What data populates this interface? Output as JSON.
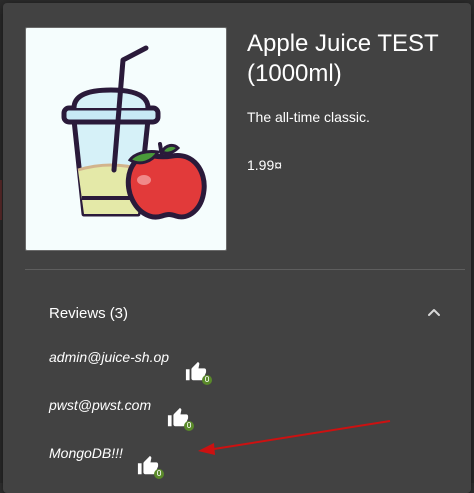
{
  "product": {
    "title": "Apple Juice TEST (1000ml)",
    "description": "The all-time classic.",
    "price": "1.99¤",
    "image_icon": "apple-juice-cup-illustration"
  },
  "reviews": {
    "label": "Reviews",
    "count": "(3)",
    "expanded": true,
    "items": [
      {
        "author": "admin@juice-sh.op",
        "likes": "0"
      },
      {
        "author": "pwst@pwst.com",
        "likes": "0"
      },
      {
        "author": "MongoDB!!!",
        "likes": "0"
      }
    ]
  },
  "colors": {
    "dialog_background": "#424242",
    "backdrop": "#2b2b2b",
    "text": "#ffffff",
    "like_badge": "#5a8a2a",
    "annotation_arrow": "#cc1111"
  }
}
